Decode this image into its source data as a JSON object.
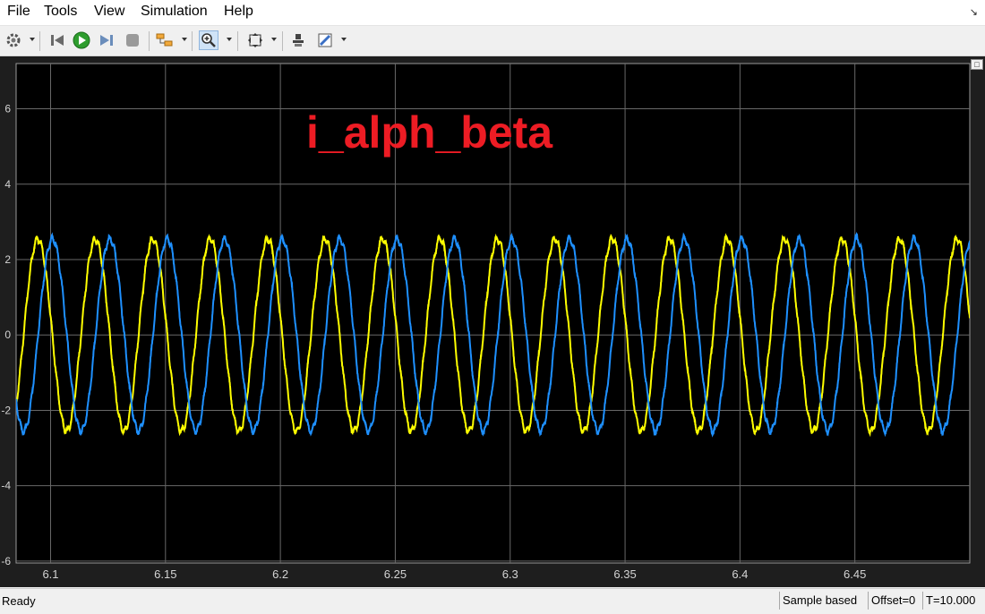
{
  "menu": [
    "File",
    "Tools",
    "View",
    "Simulation",
    "Help"
  ],
  "toolbar": {
    "buttons": [
      "settings-icon",
      "step-back-icon",
      "run-icon",
      "step-forward-icon",
      "stop-icon",
      "signal-select-icon",
      "zoom-in-icon",
      "fit-axes-icon",
      "highlight-block-icon",
      "style-icon"
    ]
  },
  "colors": {
    "series_alpha": "#ffff00",
    "series_beta": "#1e90ff",
    "title": "#ed1c24",
    "background": "#000000",
    "grid": "#686868"
  },
  "chart_data": {
    "type": "line",
    "title": "i_alph_beta",
    "xlabel": "",
    "ylabel": "",
    "xlim": [
      6.085,
      6.5
    ],
    "ylim": [
      -6.05,
      7.2
    ],
    "xticks": [
      6.1,
      6.15,
      6.2,
      6.25,
      6.3,
      6.35,
      6.4,
      6.45
    ],
    "xtick_labels": [
      "6.1",
      "6.15",
      "6.2",
      "6.25",
      "6.3",
      "6.35",
      "6.4",
      "6.45"
    ],
    "yticks": [
      -6,
      -4,
      -2,
      0,
      2,
      4,
      6
    ],
    "ytick_labels": [
      "-6",
      "-4",
      "-2",
      "0",
      "2",
      "4",
      "6"
    ],
    "grid": true,
    "series": [
      {
        "color": "#ffff00",
        "amplitude": 2.55,
        "frequency_hz": 40,
        "peak_times": [
          6.0945,
          6.1195,
          6.1445,
          6.1695,
          6.1945,
          6.2195,
          6.2445,
          6.2695,
          6.2945,
          6.3195,
          6.3445,
          6.3695,
          6.3945,
          6.4195,
          6.4445,
          6.4695,
          6.4945
        ]
      },
      {
        "color": "#1e90ff",
        "amplitude": 2.55,
        "frequency_hz": 40,
        "peak_times": [
          6.1008,
          6.1258,
          6.1508,
          6.1758,
          6.2008,
          6.2258,
          6.2508,
          6.2758,
          6.3008,
          6.3258,
          6.3508,
          6.3758,
          6.4008,
          6.4258,
          6.4508,
          6.4758
        ]
      }
    ]
  },
  "status": {
    "ready": "Ready",
    "mode": "Sample based",
    "offset": "Offset=0",
    "time": "T=10.000"
  }
}
